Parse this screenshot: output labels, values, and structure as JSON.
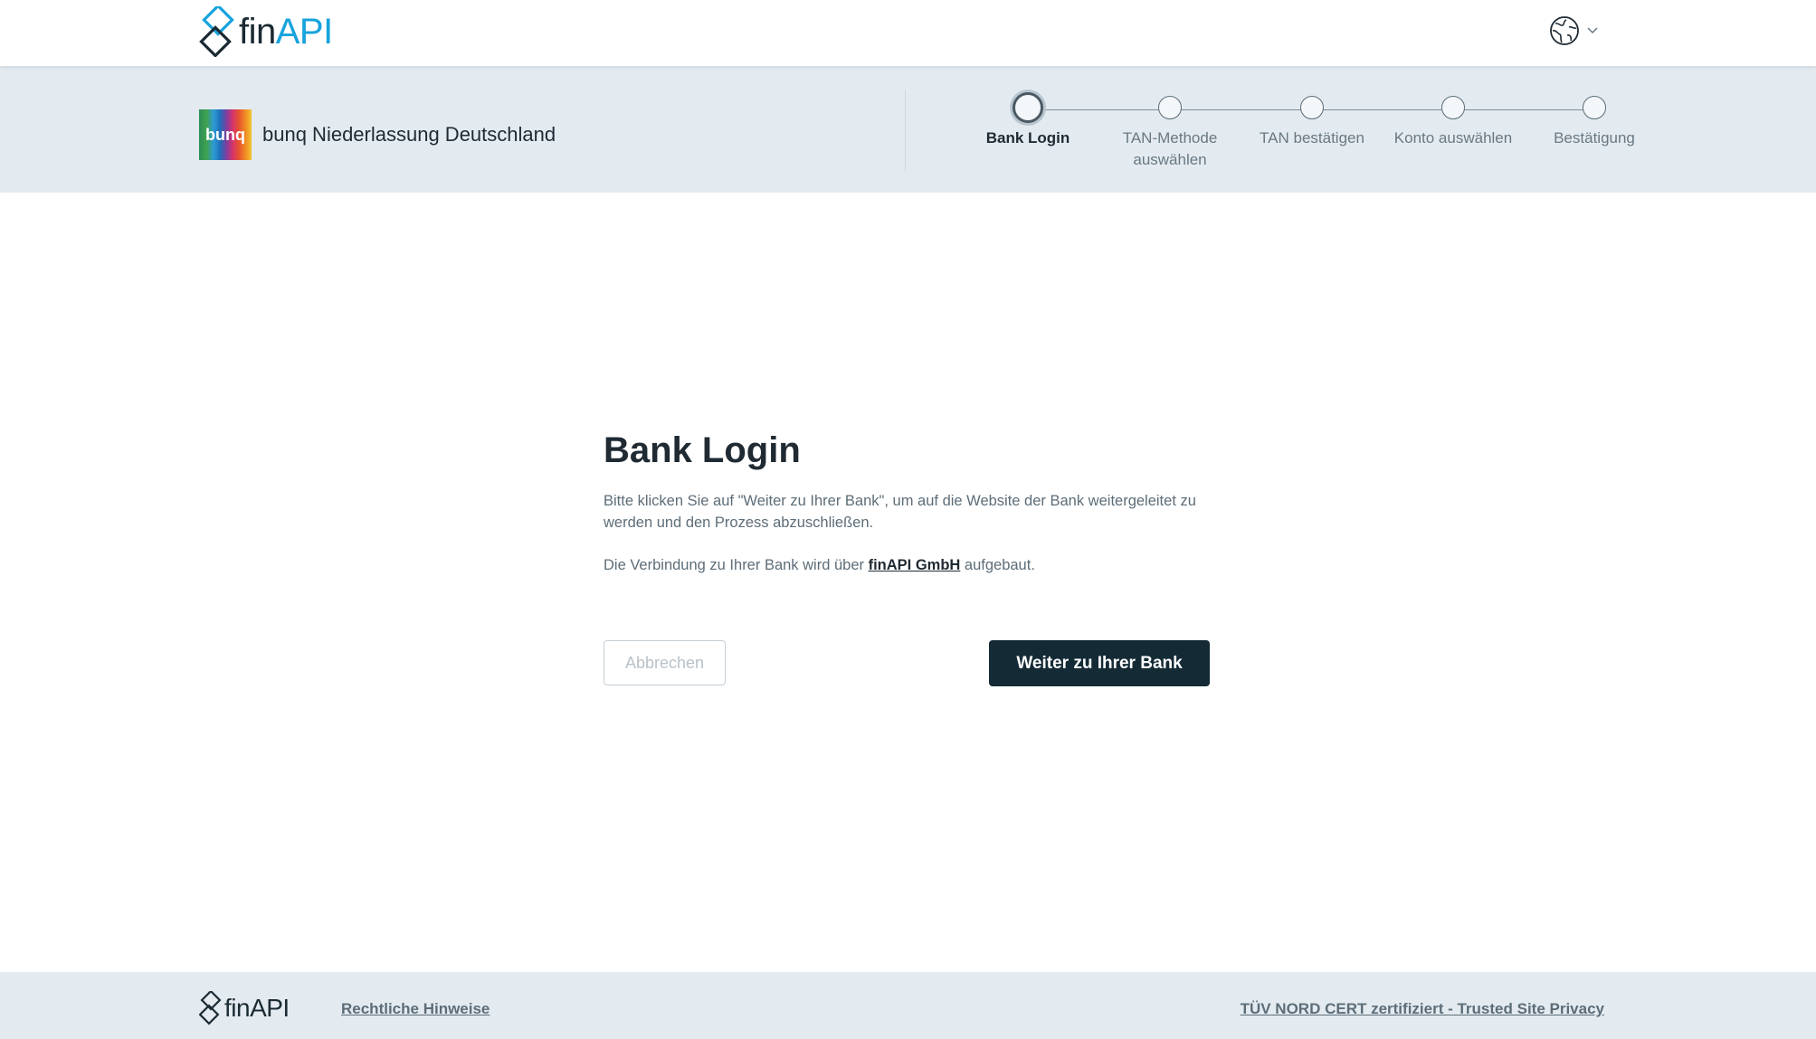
{
  "header": {
    "logo": {
      "fin": "fin",
      "api": "API"
    },
    "language_icon": "globe-icon",
    "language_chevron": "chevron-down-icon"
  },
  "bank": {
    "logo_text": "bunq",
    "name": "bunq Niederlassung Deutschland"
  },
  "stepper": {
    "steps": [
      {
        "label": "Bank Login",
        "active": true
      },
      {
        "label": "TAN-Methode auswählen",
        "active": false
      },
      {
        "label": "TAN bestätigen",
        "active": false
      },
      {
        "label": "Konto auswählen",
        "active": false
      },
      {
        "label": "Bestätigung",
        "active": false
      }
    ]
  },
  "main": {
    "title": "Bank Login",
    "paragraph1": "Bitte klicken Sie auf \"Weiter zu Ihrer Bank\", um auf die Website der Bank weitergeleitet zu werden und den Prozess abzuschließen.",
    "paragraph2_before": "Die Verbindung zu Ihrer Bank wird über ",
    "paragraph2_link": "finAPI GmbH",
    "paragraph2_after": " aufgebaut.",
    "cancel_label": "Abbrechen",
    "continue_label": "Weiter zu Ihrer Bank"
  },
  "footer": {
    "logo_text": "finAPI",
    "legal_link": "Rechtliche Hinweise",
    "cert_link": "TÜV NORD CERT zertifiziert - Trusted Site Privacy"
  },
  "colors": {
    "brand_blue": "#17a3dd",
    "dark": "#142b36",
    "band_bg": "#e3ebf1"
  }
}
